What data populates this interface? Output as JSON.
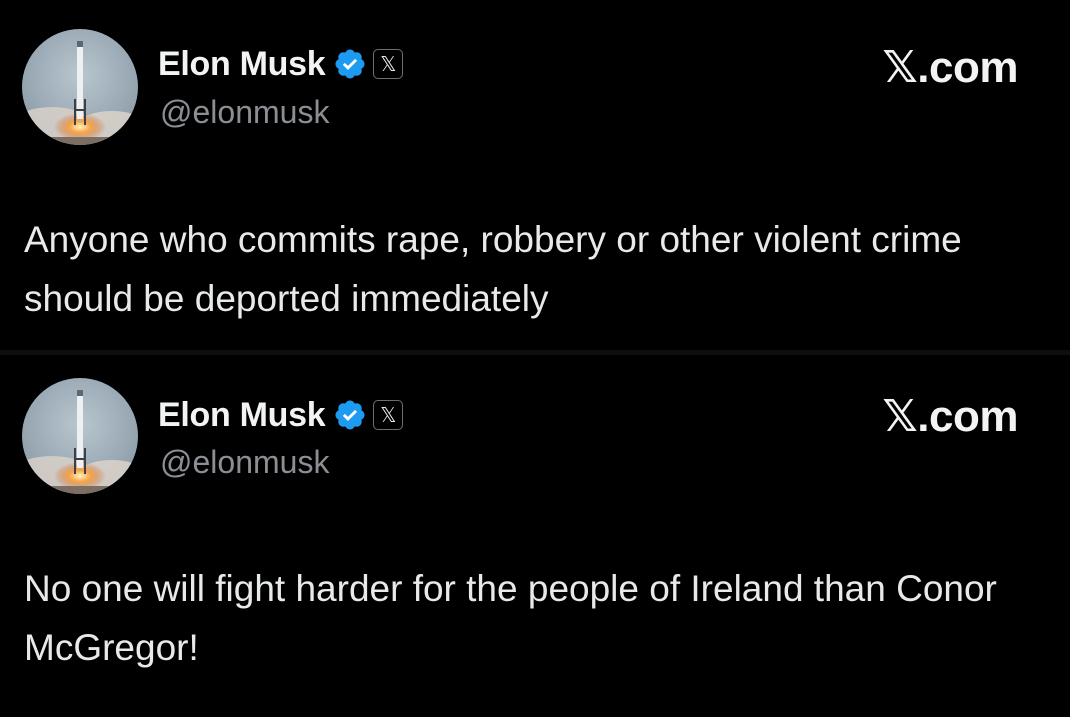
{
  "posts": [
    {
      "author": {
        "display_name": "Elon Musk",
        "handle": "@elonmusk",
        "verified_icon": "verified-check-icon",
        "affiliation_icon": "x-logo-icon",
        "affiliation_glyph": "𝕏"
      },
      "brand": "𝕏.com",
      "text": "Anyone who commits rape, robbery or other violent crime should be deported immediately"
    },
    {
      "author": {
        "display_name": "Elon Musk",
        "handle": "@elonmusk",
        "verified_icon": "verified-check-icon",
        "affiliation_icon": "x-logo-icon",
        "affiliation_glyph": "𝕏"
      },
      "brand": "𝕏.com",
      "text": "No one will fight harder for the people of Ireland than Conor McGregor!"
    }
  ],
  "colors": {
    "background": "#000000",
    "text_primary": "#e7e9ea",
    "text_secondary": "#8b8f94",
    "verified_blue": "#1d9bf0"
  }
}
